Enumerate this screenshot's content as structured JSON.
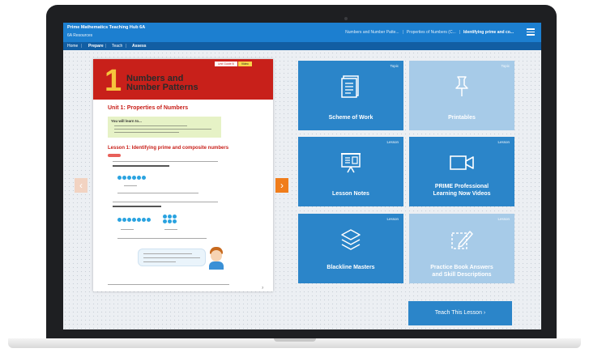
{
  "header": {
    "title": "Prime Mathematics Teaching Hub 6A",
    "subtitle": "6A Resources",
    "breadcrumbs": [
      "Numbers and Number Patte...",
      "Properties of Numbers (C...",
      "Identifying prime and co..."
    ]
  },
  "nav": {
    "items": [
      "Home",
      "Prepare",
      "Teach",
      "Assess"
    ]
  },
  "page_preview": {
    "tags": [
      "Unit Guide B",
      "Video"
    ],
    "chapter_number": "1",
    "chapter_title_line1": "Numbers and",
    "chapter_title_line2": "Number Patterns",
    "unit_title": "Unit 1: Properties of Numbers",
    "learn_heading": "You will learn to...",
    "lesson_title": "Lesson 1: Identifying prime and composite numbers",
    "page_number": "7"
  },
  "tiles": [
    {
      "type": "Topic",
      "label": "Scheme of Work",
      "icon": "document-icon"
    },
    {
      "type": "Topic",
      "label": "Printables",
      "icon": "pin-icon"
    },
    {
      "type": "Lesson",
      "label": "Lesson Notes",
      "icon": "presentation-icon"
    },
    {
      "type": "Lesson",
      "label_line1": "PRIME Professional",
      "label_line2": "Learning Now Videos",
      "icon": "video-icon"
    },
    {
      "type": "Lesson",
      "label": "Blackline Masters",
      "icon": "layers-icon"
    },
    {
      "type": "Lesson",
      "label_line1": "Practice Book Answers",
      "label_line2": "and Skill Descriptions",
      "icon": "edit-icon"
    }
  ],
  "teach_button": "Teach This Lesson  ›",
  "colors": {
    "header": "#1c7fd0",
    "nav": "#125ea3",
    "tile": "#2b85c9",
    "tile_light": "#a7cbe8",
    "next_arrow": "#f07d1b",
    "chapter_red": "#c8201a"
  }
}
